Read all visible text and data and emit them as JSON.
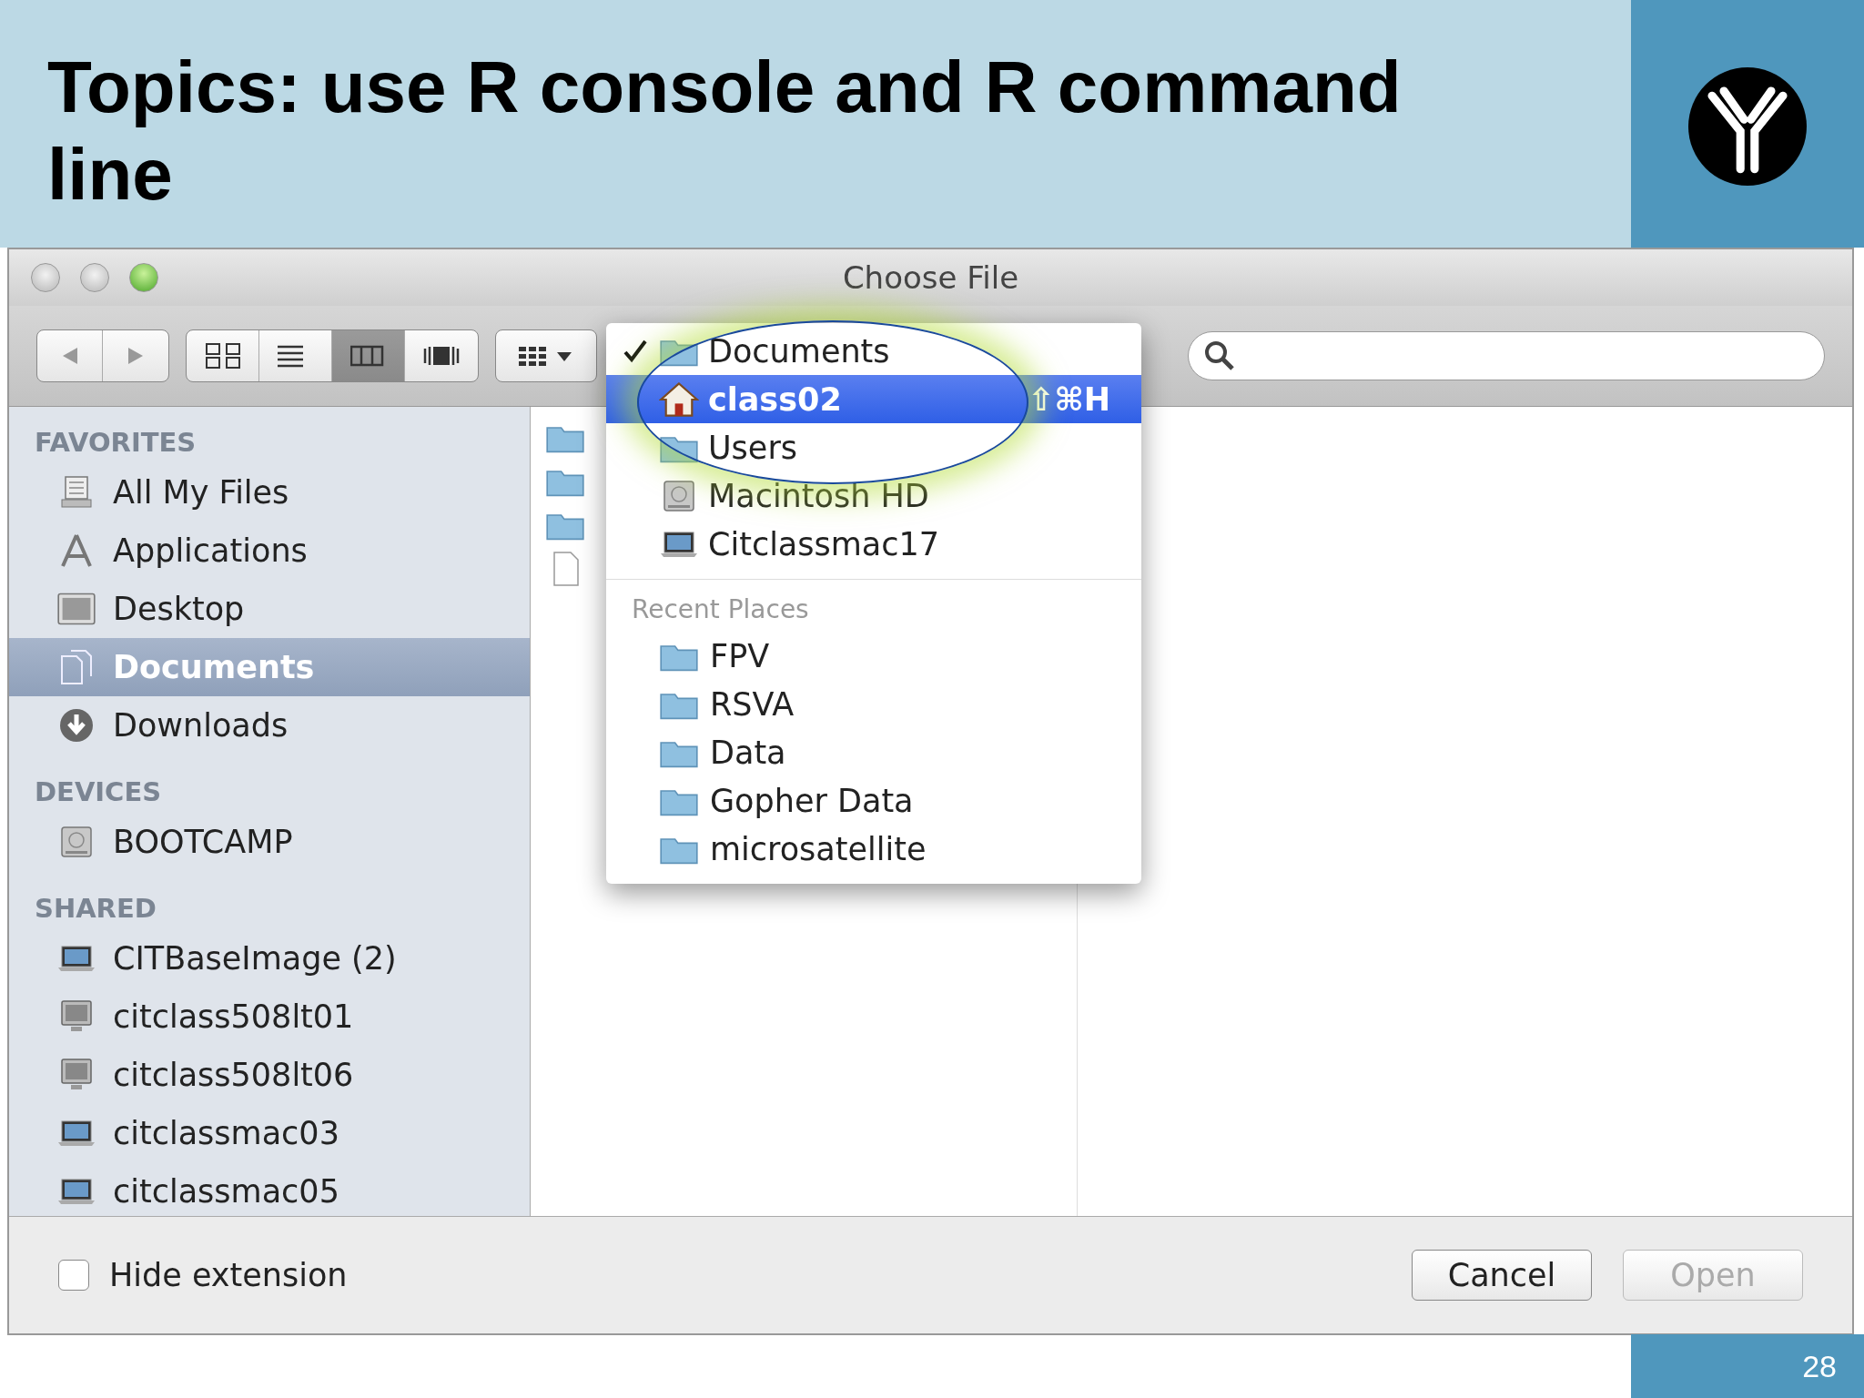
{
  "slide": {
    "title": "Topics: use R console and R command line",
    "page_number": "28"
  },
  "dialog": {
    "title": "Choose File",
    "view_modes": [
      {
        "kind": "icon",
        "selected": false
      },
      {
        "kind": "list",
        "selected": false
      },
      {
        "kind": "column",
        "selected": true
      },
      {
        "kind": "coverflow",
        "selected": false
      }
    ],
    "sidebar": [
      {
        "heading": "FAVORITES",
        "items": [
          {
            "label": "All My Files",
            "kind": "files",
            "selected": false
          },
          {
            "label": "Applications",
            "kind": "apps",
            "selected": false
          },
          {
            "label": "Desktop",
            "kind": "desktop",
            "selected": false
          },
          {
            "label": "Documents",
            "kind": "docs",
            "selected": true
          },
          {
            "label": "Downloads",
            "kind": "download",
            "selected": false
          }
        ]
      },
      {
        "heading": "DEVICES",
        "items": [
          {
            "label": "BOOTCAMP",
            "kind": "disk",
            "selected": false
          }
        ]
      },
      {
        "heading": "SHARED",
        "items": [
          {
            "label": "CITBaseImage (2)",
            "kind": "laptop",
            "selected": false
          },
          {
            "label": "citclass508lt01",
            "kind": "monitor",
            "selected": false
          },
          {
            "label": "citclass508lt06",
            "kind": "monitor",
            "selected": false
          },
          {
            "label": "citclassmac03",
            "kind": "laptop",
            "selected": false
          },
          {
            "label": "citclassmac05",
            "kind": "laptop",
            "selected": false
          }
        ]
      }
    ],
    "column_1": [
      {
        "kind": "folder"
      },
      {
        "kind": "folder"
      },
      {
        "kind": "folder"
      },
      {
        "kind": "file"
      }
    ],
    "path_menu": {
      "items": [
        {
          "label": "Documents",
          "kind": "folder",
          "checked": true,
          "selected": false
        },
        {
          "label": "class02",
          "kind": "home",
          "checked": false,
          "selected": true,
          "shortcut": "⇧⌘H"
        },
        {
          "label": "Users",
          "kind": "folder",
          "checked": false,
          "selected": false
        },
        {
          "label": "Macintosh HD",
          "kind": "disk",
          "checked": false,
          "selected": false
        },
        {
          "label": "Citclassmac17",
          "kind": "laptop",
          "checked": false,
          "selected": false
        }
      ],
      "recent_heading": "Recent Places",
      "recent": [
        {
          "label": "FPV"
        },
        {
          "label": "RSVA"
        },
        {
          "label": "Data"
        },
        {
          "label": "Gopher Data"
        },
        {
          "label": "microsatellite"
        }
      ]
    },
    "hide_extension": {
      "label": "Hide extension",
      "checked": false
    },
    "buttons": [
      {
        "label": "Cancel",
        "disabled": false
      },
      {
        "label": "Open",
        "disabled": true
      }
    ]
  }
}
